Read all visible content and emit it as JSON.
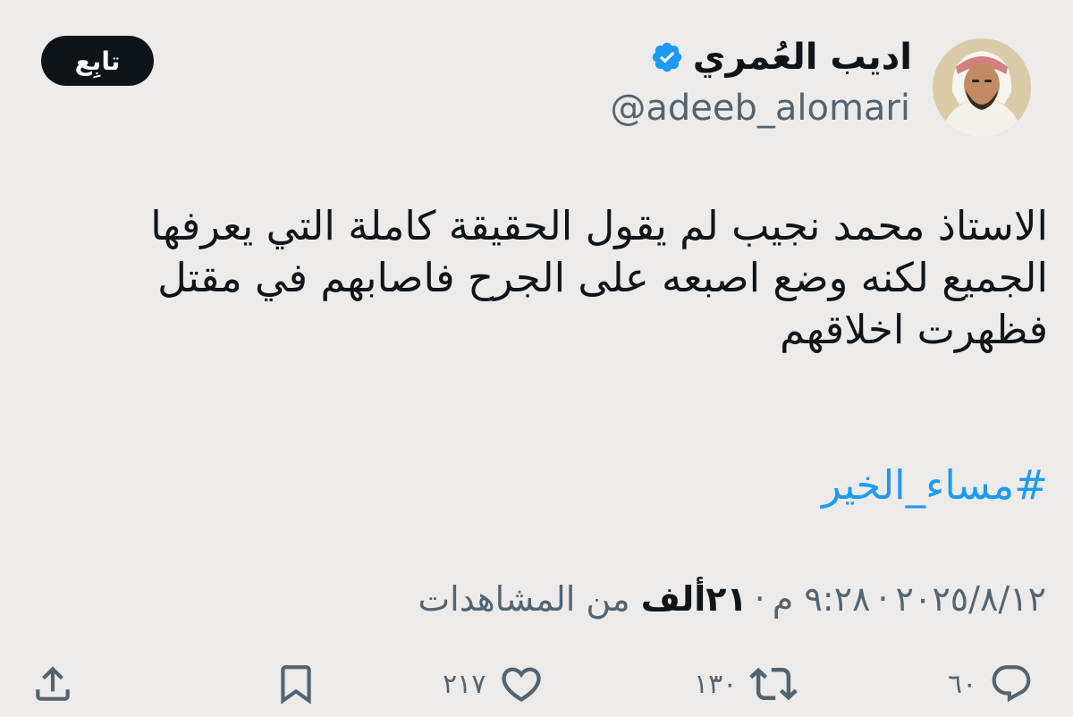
{
  "author": {
    "display_name": "اديب العُمري",
    "handle": "@adeeb_alomari",
    "verified": true,
    "verified_color": "#1d9bf0"
  },
  "follow_button": {
    "label": "تابِع"
  },
  "tweet": {
    "lines": [
      "الاستاذ محمد نجيب لم يقول الحقيقة كاملة التي يعرفها",
      "الجميع لكنه وضع اصبعه على الجرح فاصابهم في مقتل",
      "فظهرت اخلاقهم"
    ],
    "hashtag": "#مساء_الخير",
    "link_color": "#1d9bf0"
  },
  "meta": {
    "date": "٢٠٢٥/٨/١٢",
    "separator": "·",
    "time": "٩:٢٨ م",
    "views_count": "٢١ألف",
    "views_label": "من المشاهدات"
  },
  "actions": {
    "replies": {
      "icon": "reply-icon",
      "count": "٦٠"
    },
    "reposts": {
      "icon": "repost-icon",
      "count": "١٣٠"
    },
    "likes": {
      "icon": "heart-icon",
      "count": "٢١٧"
    },
    "bookmark": {
      "icon": "bookmark-icon"
    },
    "share": {
      "icon": "share-icon"
    }
  }
}
